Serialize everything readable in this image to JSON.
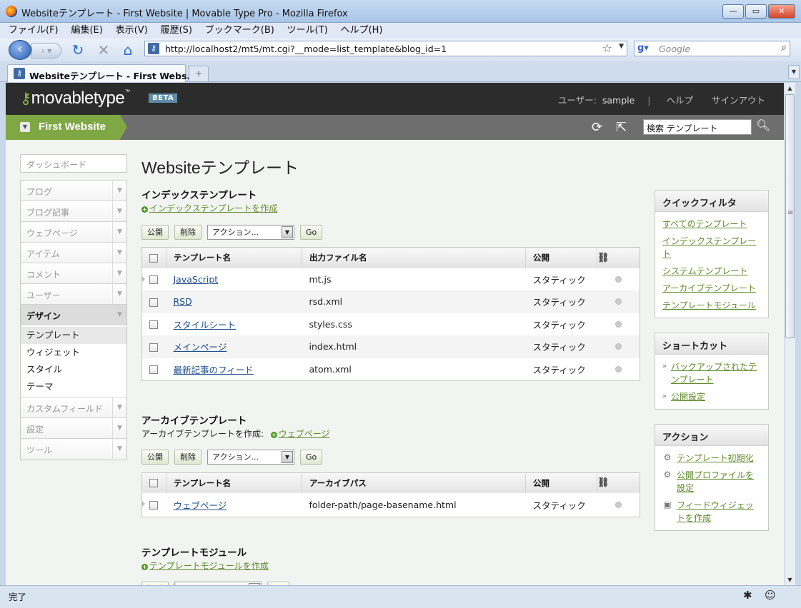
{
  "window": {
    "title": "Websiteテンプレート - First Website | Movable Type Pro - Mozilla Firefox",
    "minimize": "—",
    "maximize": "▭",
    "close": "✕"
  },
  "menubar": [
    "ファイル(F)",
    "編集(E)",
    "表示(V)",
    "履歴(S)",
    "ブックマーク(B)",
    "ツール(T)",
    "ヘルプ(H)"
  ],
  "nav": {
    "url": "http://localhost2/mt5/mt.cgi?__mode=list_template&blog_id=1",
    "search_placeholder": "Google"
  },
  "tab": {
    "label": "Websiteテンプレート - First Webs..."
  },
  "header": {
    "logo": "movabletype",
    "beta": "BETA",
    "user_label": "ユーザー:",
    "user_name": "sample",
    "help": "ヘルプ",
    "signout": "サインアウト"
  },
  "blog": {
    "name": "First Website",
    "search_value": "検索 テンプレート"
  },
  "leftnav": {
    "dashboard": "ダッシュボード",
    "items": [
      "ブログ",
      "ブログ記事",
      "ウェブページ",
      "アイテム",
      "コメント",
      "ユーザー"
    ],
    "active": "デザイン",
    "sub": [
      "テンプレート",
      "ウィジェット",
      "スタイル",
      "テーマ"
    ],
    "items_after": [
      "カスタムフィールド",
      "設定",
      "ツール"
    ]
  },
  "page": {
    "title": "Websiteテンプレート"
  },
  "controls": {
    "publish": "公開",
    "delete": "削除",
    "action": "アクション...",
    "go": "Go"
  },
  "index_section": {
    "title": "インデックステンプレート",
    "create": "インデックステンプレートを作成",
    "headers": [
      "テンプレート名",
      "出力ファイル名",
      "公開"
    ],
    "rows": [
      {
        "name": "JavaScript",
        "file": "mt.js",
        "publish": "スタティック"
      },
      {
        "name": "RSD",
        "file": "rsd.xml",
        "publish": "スタティック"
      },
      {
        "name": "スタイルシート",
        "file": "styles.css",
        "publish": "スタティック"
      },
      {
        "name": "メインページ",
        "file": "index.html",
        "publish": "スタティック"
      },
      {
        "name": "最新記事のフィード",
        "file": "atom.xml",
        "publish": "スタティック"
      }
    ]
  },
  "archive_section": {
    "title": "アーカイブテンプレート",
    "create_label": "アーカイブテンプレートを作成:",
    "create_link": "ウェブページ",
    "headers": [
      "テンプレート名",
      "アーカイブパス",
      "公開"
    ],
    "rows": [
      {
        "name": "ウェブページ",
        "file": "folder-path/page-basename.html",
        "publish": "スタティック"
      }
    ]
  },
  "module_section": {
    "title": "テンプレートモジュール",
    "create": "テンプレートモジュールを作成"
  },
  "quickfilter": {
    "title": "クイックフィルタ",
    "links": [
      "すべてのテンプレート",
      "インデックステンプレート",
      "システムテンプレート",
      "アーカイブテンプレート",
      "テンプレートモジュール"
    ]
  },
  "shortcuts": {
    "title": "ショートカット",
    "links": [
      "バックアップされたテンプレート",
      "公開設定"
    ]
  },
  "actions": {
    "title": "アクション",
    "links": [
      "テンプレート初期化",
      "公開プロファイルを設定",
      "フィードウィジェットを作成"
    ]
  },
  "status": {
    "text": "完了"
  }
}
